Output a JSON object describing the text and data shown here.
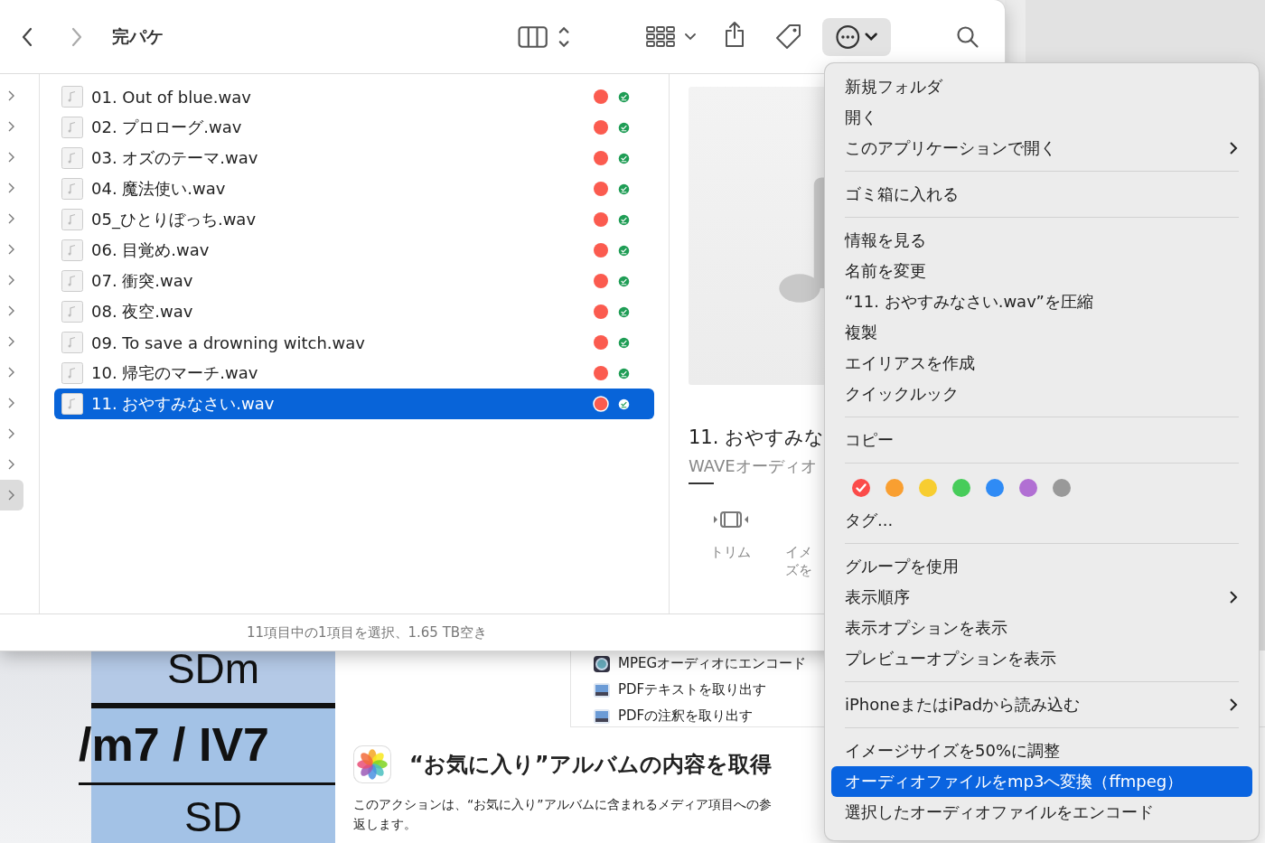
{
  "toolbar": {
    "title": "完パケ"
  },
  "parent_rows": [
    {
      "selected": false
    },
    {
      "selected": false
    },
    {
      "selected": false
    },
    {
      "selected": false
    },
    {
      "selected": false
    },
    {
      "selected": false
    },
    {
      "selected": false
    },
    {
      "selected": false
    },
    {
      "selected": false
    },
    {
      "selected": false
    },
    {
      "selected": false
    },
    {
      "selected": false
    },
    {
      "selected": false
    },
    {
      "selected": true
    }
  ],
  "files": [
    {
      "name": "01. Out of blue.wav",
      "selected": false
    },
    {
      "name": "02. プロローグ.wav",
      "selected": false
    },
    {
      "name": "03. オズのテーマ.wav",
      "selected": false
    },
    {
      "name": "04. 魔法使い.wav",
      "selected": false
    },
    {
      "name": "05_ひとりぼっち.wav",
      "selected": false
    },
    {
      "name": "06. 目覚め.wav",
      "selected": false
    },
    {
      "name": "07. 衝突.wav",
      "selected": false
    },
    {
      "name": "08. 夜空.wav",
      "selected": false
    },
    {
      "name": "09. To save a drowning witch.wav",
      "selected": false
    },
    {
      "name": "10. 帰宅のマーチ.wav",
      "selected": false
    },
    {
      "name": "11. おやすみなさい.wav",
      "selected": true
    }
  ],
  "preview": {
    "title": "11. おやすみな",
    "subtitle": "WAVEオーディオ",
    "actions": [
      {
        "label": "トリム",
        "kind": "trim"
      },
      {
        "label": "イメズを",
        "kind": "cut"
      }
    ]
  },
  "status_bar": "11項目中の1項目を選択、1.65 TB空き",
  "background": {
    "chord_sheet": [
      "SDm",
      "/m7 / IV7",
      "SD"
    ],
    "action_list": [
      {
        "label": "MPEGオーディオにエンコード",
        "kind": "quicktime"
      },
      {
        "label": "PDFテキストを取り出す",
        "kind": "preview"
      },
      {
        "label": "PDFの注釈を取り出す",
        "kind": "preview"
      }
    ],
    "action_title": "“お気に入り”アルバムの内容を取得",
    "description": [
      "このアクションは、“お気に入り”アルバムに含まれるメディア項目への参",
      "返します。"
    ]
  },
  "menu": [
    [
      {
        "kind": "item",
        "label": "新規フォルダ",
        "submenu": false,
        "selected": false
      },
      {
        "kind": "item",
        "label": "開く",
        "submenu": false,
        "selected": false
      },
      {
        "kind": "item",
        "label": "このアプリケーションで開く",
        "submenu": true,
        "selected": false
      }
    ],
    [
      {
        "kind": "item",
        "label": "ゴミ箱に入れる",
        "submenu": false,
        "selected": false
      }
    ],
    [
      {
        "kind": "item",
        "label": "情報を見る",
        "submenu": false,
        "selected": false
      },
      {
        "kind": "item",
        "label": "名前を変更",
        "submenu": false,
        "selected": false
      },
      {
        "kind": "item",
        "label": "“11. おやすみなさい.wav”を圧縮",
        "submenu": false,
        "selected": false
      },
      {
        "kind": "item",
        "label": "複製",
        "submenu": false,
        "selected": false
      },
      {
        "kind": "item",
        "label": "エイリアスを作成",
        "submenu": false,
        "selected": false
      },
      {
        "kind": "item",
        "label": "クイックルック",
        "submenu": false,
        "selected": false
      }
    ],
    [
      {
        "kind": "item",
        "label": "コピー",
        "submenu": false,
        "selected": false
      }
    ],
    [
      {
        "kind": "tags",
        "colors": [
          {
            "color": "#fb4b49",
            "checked": true
          },
          {
            "color": "#f99f31",
            "checked": false
          },
          {
            "color": "#f7cd30",
            "checked": false
          },
          {
            "color": "#47cc5a",
            "checked": false
          },
          {
            "color": "#2f8bf5",
            "checked": false
          },
          {
            "color": "#b16fd3",
            "checked": false
          },
          {
            "color": "#999999",
            "checked": false
          }
        ]
      },
      {
        "kind": "item",
        "label": "タグ...",
        "submenu": false,
        "selected": false
      }
    ],
    [
      {
        "kind": "item",
        "label": "グループを使用",
        "submenu": false,
        "selected": false
      },
      {
        "kind": "item",
        "label": "表示順序",
        "submenu": true,
        "selected": false
      },
      {
        "kind": "item",
        "label": "表示オプションを表示",
        "submenu": false,
        "selected": false
      },
      {
        "kind": "item",
        "label": "プレビューオプションを表示",
        "submenu": false,
        "selected": false
      }
    ],
    [
      {
        "kind": "item",
        "label": "iPhoneまたはiPadから読み込む",
        "submenu": true,
        "selected": false
      }
    ],
    [
      {
        "kind": "item",
        "label": "イメージサイズを50%に調整",
        "submenu": false,
        "selected": false
      },
      {
        "kind": "item",
        "label": "オーディオファイルをmp3へ変換（ffmpeg）",
        "submenu": false,
        "selected": true
      },
      {
        "kind": "item",
        "label": "選択したオーディオファイルをエンコード",
        "submenu": false,
        "selected": false
      }
    ]
  ]
}
